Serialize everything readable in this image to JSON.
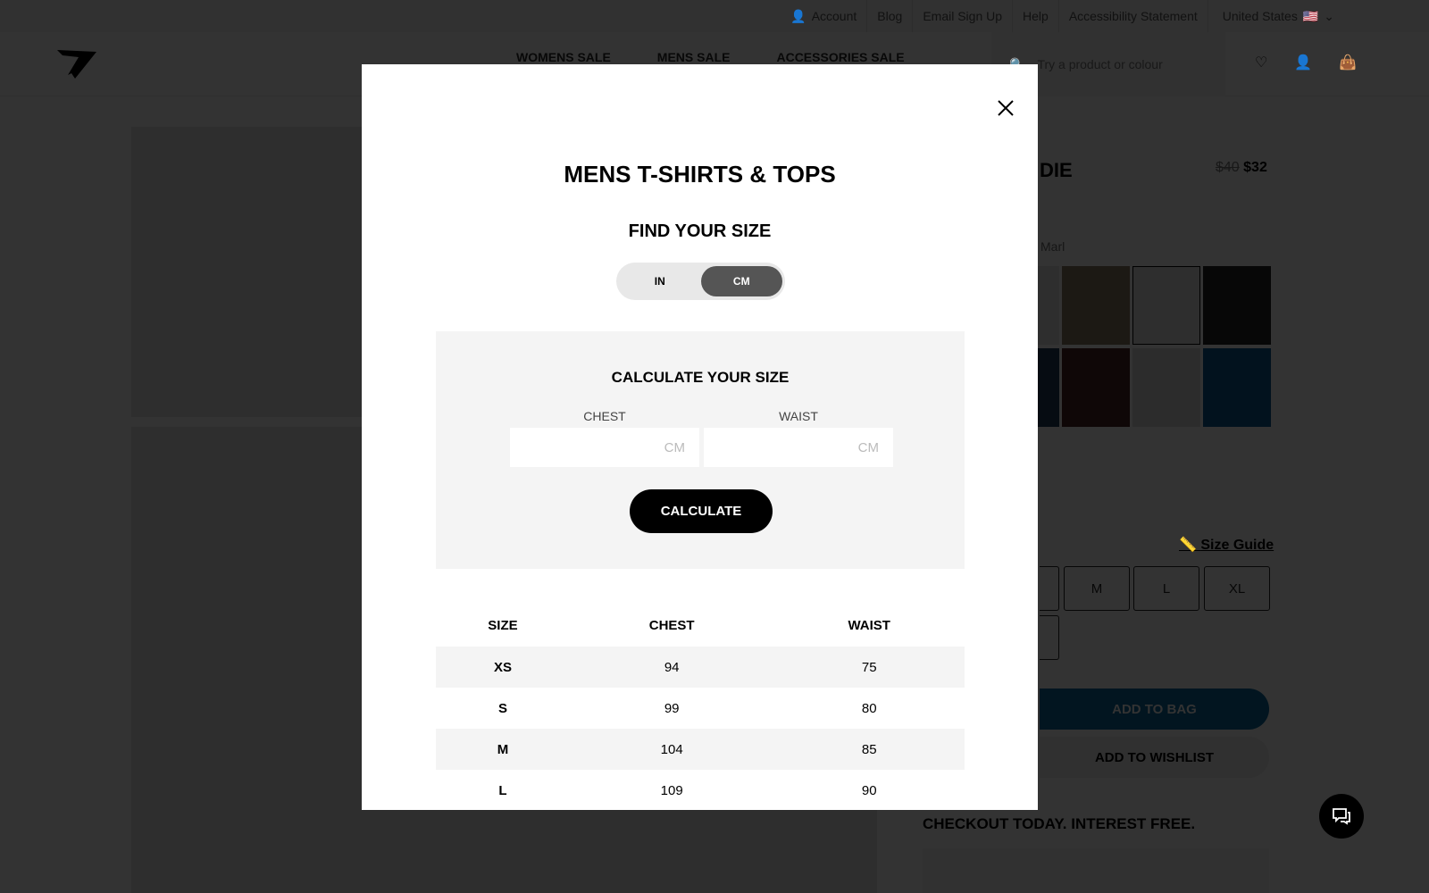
{
  "topbar": {
    "links": [
      "Account",
      "Blog",
      "Email Sign Up",
      "Help",
      "Accessibility Statement"
    ],
    "country": "United States"
  },
  "header": {
    "nav": [
      "WOMENS SALE",
      "MENS SALE",
      "ACCESSORIES SALE"
    ],
    "search_placeholder": "Try a product or colour"
  },
  "product": {
    "title_visible": "DIE",
    "old_price": "$40",
    "price": "$32",
    "colour_visible": "Marl",
    "size_guide": "Size Guide",
    "sizes": [
      "M",
      "L",
      "XL"
    ],
    "add_to_bag": "ADD TO BAG",
    "add_to_wishlist": "ADD TO WISHLIST",
    "checkout": "CHECKOUT TODAY. INTEREST FREE."
  },
  "modal": {
    "title": "MENS T-SHIRTS & TOPS",
    "subtitle": "FIND YOUR SIZE",
    "units": [
      "IN",
      "CM"
    ],
    "selected_unit": "CM",
    "calc_title": "CALCULATE YOUR SIZE",
    "chest_label": "CHEST",
    "waist_label": "WAIST",
    "chest_placeholder": "CM",
    "waist_placeholder": "CM",
    "calc_button": "CALCULATE",
    "table": {
      "headers": [
        "SIZE",
        "CHEST",
        "WAIST"
      ],
      "rows": [
        [
          "XS",
          "94",
          "75"
        ],
        [
          "S",
          "99",
          "80"
        ],
        [
          "M",
          "104",
          "85"
        ],
        [
          "L",
          "109",
          "90"
        ]
      ]
    }
  },
  "colors": {
    "accent": "#0a6aa1",
    "overlay": "rgba(0,0,0,0.8)"
  }
}
